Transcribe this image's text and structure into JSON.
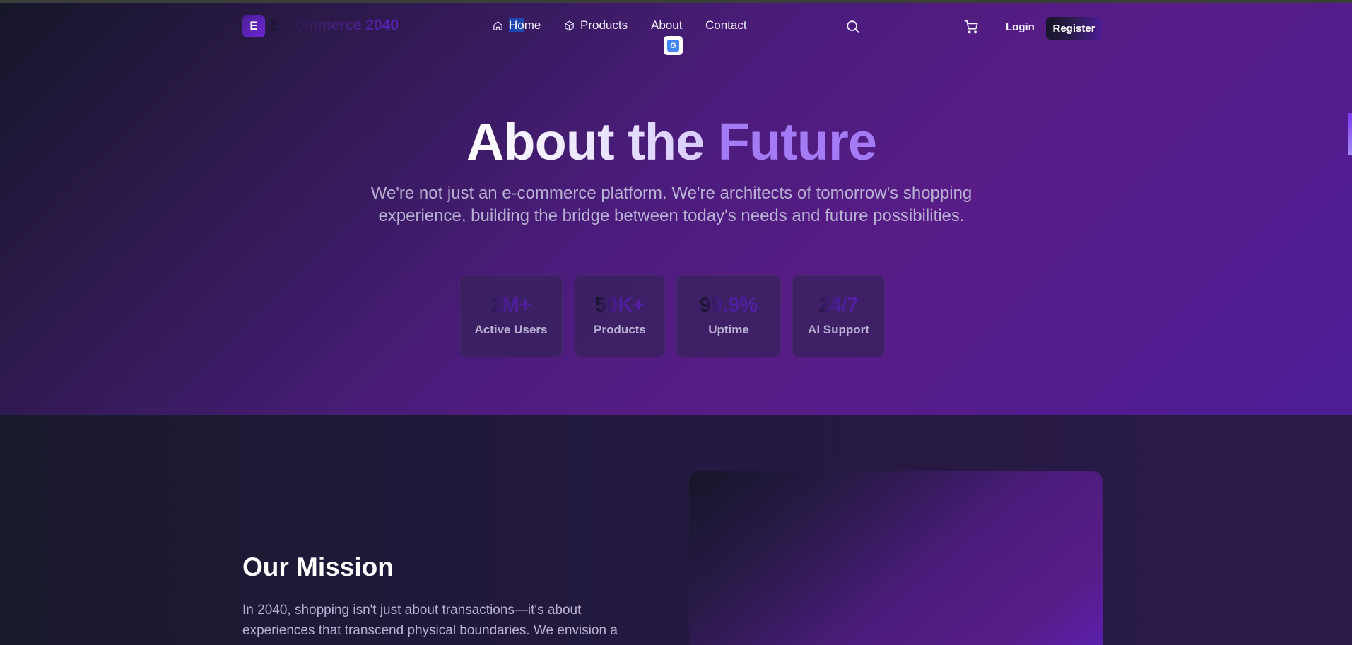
{
  "brand": {
    "logo_letter": "E",
    "name": "E-Commerce 2040"
  },
  "nav": {
    "home_prefix": "Ho",
    "home_suffix": "me",
    "products": "Products",
    "about": "About",
    "contact": "Contact",
    "login": "Login",
    "register": "Register"
  },
  "icons": {
    "home": "home-icon",
    "products": "box-icon",
    "search": "search-icon",
    "cart": "cart-icon",
    "translate": "google-translate-icon"
  },
  "hero": {
    "title_part1": "About the ",
    "title_part2": "Future",
    "subtitle": "We're not just an e-commerce platform. We're architects of tomorrow's shopping experience, building the bridge between today's needs and future possibilities."
  },
  "stats": [
    {
      "value": "2M+",
      "label": "Active Users"
    },
    {
      "value": "50K+",
      "label": "Products"
    },
    {
      "value": "99.9%",
      "label": "Uptime"
    },
    {
      "value": "24/7",
      "label": "AI Support"
    }
  ],
  "mission": {
    "title": "Our Mission",
    "text": "In 2040, shopping isn't just about transactions—it's about experiences that transcend physical boundaries. We envision a"
  },
  "colors": {
    "accent": "#a47bf5",
    "brand_purple": "#581c87",
    "selection_highlight": "#1e47b4"
  }
}
